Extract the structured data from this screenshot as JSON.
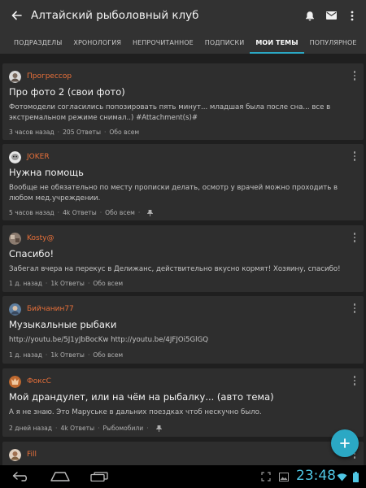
{
  "app": {
    "title": "Алтайский рыболовный клуб"
  },
  "tabs": [
    {
      "label": ""
    },
    {
      "label": "ПОДРАЗДЕЛЫ"
    },
    {
      "label": "ХРОНОЛОГИЯ"
    },
    {
      "label": "НЕПРОЧИТАННОЕ"
    },
    {
      "label": "ПОДПИСКИ"
    },
    {
      "label": "МОИ ТЕМЫ",
      "active": true
    },
    {
      "label": "ПОПУЛЯРНОЕ"
    }
  ],
  "colors": {
    "accent": "#2ba8c4",
    "author": "#e8703a",
    "card": "#2e2e2e",
    "background": "#1f1f1f",
    "bar": "#323232"
  },
  "topics": [
    {
      "author": "Прогрессор",
      "title": "Про фото 2 (свои фото)",
      "excerpt": "Фотомодели согласились попозировать пять минут... младшая была после сна... все в экстремальном режиме снимал..) #Attachment(s)#",
      "time": "3 часов назад",
      "replies": "205 Ответы",
      "visibility": "Обо всем",
      "pinned": false
    },
    {
      "author": "JOKER",
      "title": "Нужна помощь",
      "excerpt": "Вообще не обязательно по месту прописки делать, осмотр у врачей можно проходить в любом мед.учреждении.",
      "time": "5 часов назад",
      "replies": "4k Ответы",
      "visibility": "Обо всем",
      "pinned": true
    },
    {
      "author": "Kosty@",
      "title": "Спасибо!",
      "excerpt": "Забегал вчера на перекус в Делижанс, действительно вкусно кормят! Хозяину, спасибо!",
      "time": "1 д. назад",
      "replies": "1k Ответы",
      "visibility": "Обо всем",
      "pinned": false
    },
    {
      "author": "Бийчанин77",
      "title": "Музыкальные рыбаки",
      "excerpt": "http://youtu.be/5J1yJbBocKw http://youtu.be/4JFJOi5GlGQ",
      "time": "1 д. назад",
      "replies": "1k Ответы",
      "visibility": "Обо всем",
      "pinned": false
    },
    {
      "author": "ФоксС",
      "title": "Мой драндулет, или на чём на рыбалку... (авто тема)",
      "excerpt": "А я не знаю. Это Маруське в дальних поездках чтоб нескучно было.",
      "time": "2 дней назад",
      "replies": "4k Ответы",
      "visibility": "Рыбомобили",
      "pinned": true
    },
    {
      "author": "Fill",
      "title": "",
      "excerpt": "",
      "time": "",
      "replies": "",
      "visibility": "",
      "pinned": false
    }
  ],
  "status": {
    "time": "23:48"
  },
  "icons": {
    "back": "back-arrow-icon",
    "notifications": "bell-icon",
    "messages": "envelope-icon",
    "overflow": "more-vert-icon",
    "fab": "plus-icon",
    "nav": [
      "nav-back-icon",
      "nav-home-icon",
      "nav-recents-icon"
    ],
    "status": [
      "fullscreen-icon",
      "image-icon",
      "wifi-icon",
      "battery-icon"
    ]
  }
}
